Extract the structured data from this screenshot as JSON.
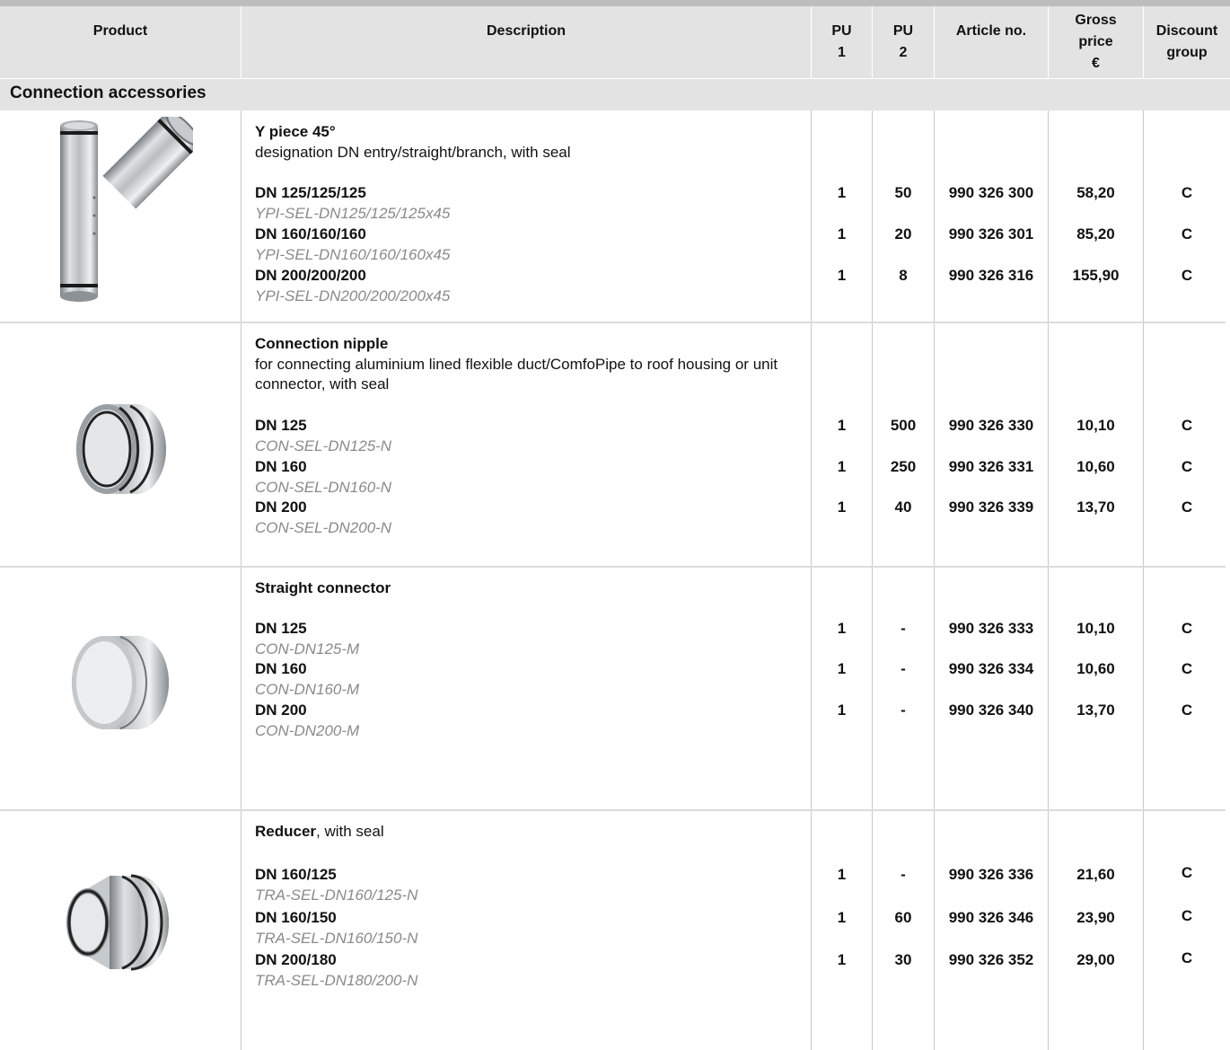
{
  "header": {
    "product": "Product",
    "description": "Description",
    "pu1_line1": "PU",
    "pu1_line2": "1",
    "pu2_line1": "PU",
    "pu2_line2": "2",
    "article": "Article no.",
    "price_line1": "Gross",
    "price_line2": "price",
    "price_line3": "€",
    "disc_line1": "Discount",
    "disc_line2": "group"
  },
  "section": {
    "title": "Connection accessories"
  },
  "products": [
    {
      "title": "Y piece 45°",
      "description": "designation DN entry/straight/branch, with seal",
      "variants": [
        {
          "name": "DN 125/125/125",
          "code": "YPI-SEL-DN125/125/125x45",
          "pu1": "1",
          "pu2": "50",
          "article": "990 326 300",
          "price": "58,20",
          "discount": "C"
        },
        {
          "name": "DN 160/160/160",
          "code": "YPI-SEL-DN160/160/160x45",
          "pu1": "1",
          "pu2": "20",
          "article": "990 326 301",
          "price": "85,20",
          "discount": "C"
        },
        {
          "name": "DN 200/200/200",
          "code": "YPI-SEL-DN200/200/200x45",
          "pu1": "1",
          "pu2": "8",
          "article": "990 326 316",
          "price": "155,90",
          "discount": "C"
        }
      ]
    },
    {
      "title": "Connection nipple",
      "description": "for connecting aluminium lined flexible duct/ComfoPipe to roof housing or unit connector, with seal",
      "variants": [
        {
          "name": "DN 125",
          "code": "CON-SEL-DN125-N",
          "pu1": "1",
          "pu2": "500",
          "article": "990 326 330",
          "price": "10,10",
          "discount": "C"
        },
        {
          "name": "DN 160",
          "code": "CON-SEL-DN160-N",
          "pu1": "1",
          "pu2": "250",
          "article": "990 326 331",
          "price": "10,60",
          "discount": "C"
        },
        {
          "name": "DN 200",
          "code": "CON-SEL-DN200-N",
          "pu1": "1",
          "pu2": "40",
          "article": "990 326 339",
          "price": "13,70",
          "discount": "C"
        }
      ]
    },
    {
      "title": "Straight connector",
      "description": "",
      "variants": [
        {
          "name": "DN 125",
          "code": "CON-DN125-M",
          "pu1": "1",
          "pu2": "-",
          "article": "990 326 333",
          "price": "10,10",
          "discount": "C"
        },
        {
          "name": "DN 160",
          "code": "CON-DN160-M",
          "pu1": "1",
          "pu2": "-",
          "article": "990 326 334",
          "price": "10,60",
          "discount": "C"
        },
        {
          "name": "DN 200",
          "code": "CON-DN200-M",
          "pu1": "1",
          "pu2": "-",
          "article": "990 326 340",
          "price": "13,70",
          "discount": "C"
        }
      ]
    },
    {
      "title": "Reducer",
      "title_suffix": ", with seal",
      "description": "",
      "variants": [
        {
          "name": "DN 160/125",
          "code": "TRA-SEL-DN160/125-N",
          "pu1": "1",
          "pu2": "-",
          "article": "990 326 336",
          "price": "21,60",
          "discount": "C"
        },
        {
          "name": "DN 160/150",
          "code": "TRA-SEL-DN160/150-N",
          "pu1": "1",
          "pu2": "60",
          "article": "990 326 346",
          "price": "23,90",
          "discount": "C"
        },
        {
          "name": "DN 200/180",
          "code": "TRA-SEL-DN180/200-N",
          "pu1": "1",
          "pu2": "30",
          "article": "990 326 352",
          "price": "29,00",
          "discount": "C"
        }
      ]
    }
  ]
}
